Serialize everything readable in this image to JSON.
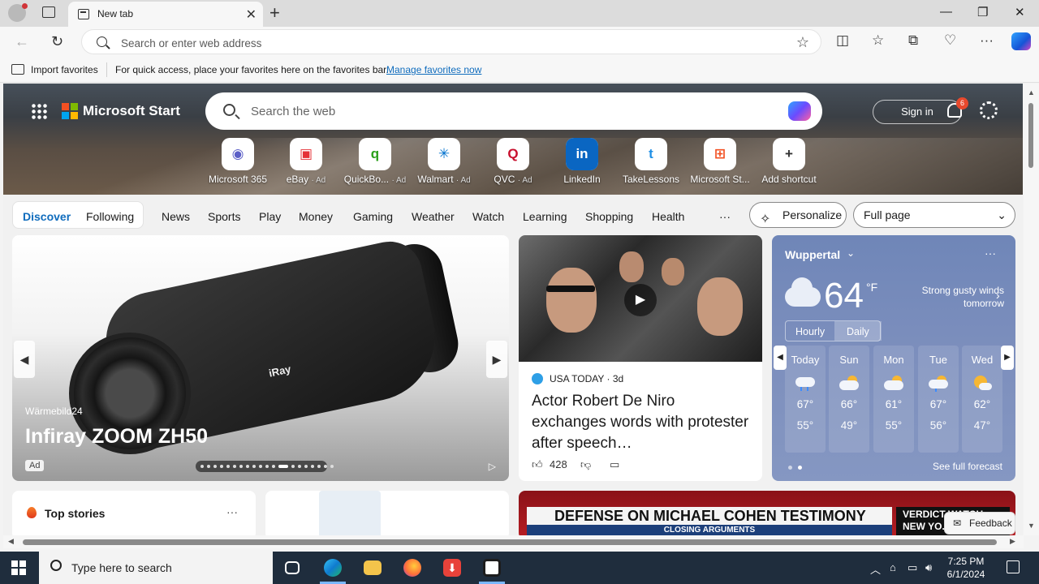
{
  "browser": {
    "tab_title": "New tab",
    "address_placeholder": "Search or enter web address",
    "favbar": {
      "import_label": "Import favorites",
      "message": "For quick access, place your favorites here on the favorites bar.",
      "link": "Manage favorites now"
    }
  },
  "header": {
    "brand": "Microsoft Start",
    "search_placeholder": "Search the web",
    "signin": "Sign in",
    "notification_count": "6"
  },
  "shortcuts": [
    {
      "label": "Microsoft 365",
      "ad": "",
      "icon": "microsoft-365-icon"
    },
    {
      "label": "eBay",
      "ad": "· Ad",
      "icon": "ebay-icon"
    },
    {
      "label": "QuickBo...",
      "ad": "· Ad",
      "icon": "quickbooks-icon"
    },
    {
      "label": "Walmart",
      "ad": "· Ad",
      "icon": "walmart-icon"
    },
    {
      "label": "QVC",
      "ad": "· Ad",
      "icon": "qvc-icon"
    },
    {
      "label": "LinkedIn",
      "ad": "",
      "icon": "linkedin-icon"
    },
    {
      "label": "TakeLessons",
      "ad": "",
      "icon": "takelessons-icon"
    },
    {
      "label": "Microsoft St...",
      "ad": "",
      "icon": "microsoft-store-icon"
    },
    {
      "label": "Add shortcut",
      "ad": "",
      "icon": "plus-icon"
    }
  ],
  "nav": {
    "discover": "Discover",
    "following": "Following",
    "items": [
      "News",
      "Sports",
      "Play",
      "Money",
      "Gaming",
      "Weather",
      "Watch",
      "Learning",
      "Shopping",
      "Health"
    ],
    "more": "···",
    "personalize": "Personalize",
    "layout": "Full page"
  },
  "ad_card": {
    "source": "Wärmebild24",
    "title": "Infiray ZOOM ZH50",
    "tag": "Ad",
    "brand_print": "iRay",
    "slide_count": 20,
    "active_slide": 12
  },
  "news_card": {
    "source": "USA TODAY",
    "age": "· 3d",
    "headline": "Actor Robert De Niro exchanges words with protester after speech…",
    "likes": "428"
  },
  "weather": {
    "city": "Wuppertal",
    "temp": "64",
    "unit": "°F",
    "note": "Strong gusty winds tomorrow",
    "tabs": [
      "Hourly",
      "Daily"
    ],
    "active_tab": "Daily",
    "days": [
      {
        "name": "Today",
        "hi": "67°",
        "lo": "55°",
        "icon": "rain-cloud-icon"
      },
      {
        "name": "Sun",
        "hi": "66°",
        "lo": "49°",
        "icon": "partly-cloudy-icon"
      },
      {
        "name": "Mon",
        "hi": "61°",
        "lo": "55°",
        "icon": "partly-cloudy-icon"
      },
      {
        "name": "Tue",
        "hi": "67°",
        "lo": "56°",
        "icon": "partly-cloudy-rain-icon"
      },
      {
        "name": "Wed",
        "hi": "62°",
        "lo": "47°",
        "icon": "sunny-cloudy-icon"
      }
    ],
    "footer": "See full forecast"
  },
  "top_stories": {
    "title": "Top stories",
    "more": "···"
  },
  "video_card": {
    "ticker": "DEFENSE ON MICHAEL COHEN TESTIMONY",
    "sub": "CLOSING ARGUMENTS",
    "side": "VERDICT WATCH NEW YO..."
  },
  "feedback": "Feedback",
  "taskbar": {
    "search": "Type here to search",
    "time": "7:25 PM",
    "date": "6/1/2024"
  }
}
